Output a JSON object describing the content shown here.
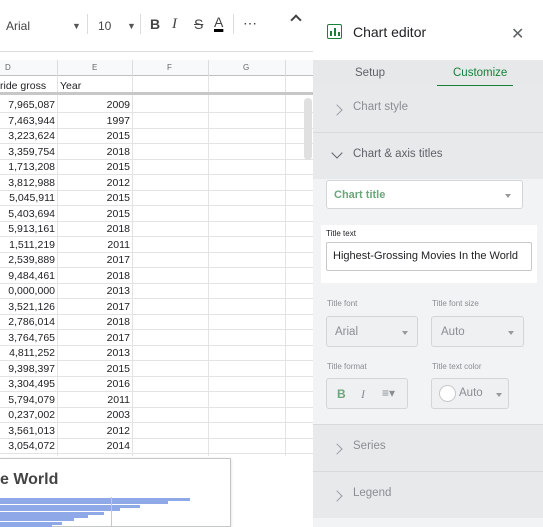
{
  "toolbar": {
    "font_name": "Arial",
    "font_size": "10",
    "bold": "B",
    "italic": "I",
    "strikethrough": "S",
    "text_color": "A",
    "more": "⋯"
  },
  "columns": [
    "D",
    "E",
    "F",
    "G"
  ],
  "sheet": {
    "header_gross": "ride gross",
    "header_year": "Year",
    "rows": [
      {
        "gross": "7,965,087",
        "year": "2009"
      },
      {
        "gross": "7,463,944",
        "year": "1997"
      },
      {
        "gross": "3,223,624",
        "year": "2015"
      },
      {
        "gross": "3,359,754",
        "year": "2018"
      },
      {
        "gross": "1,713,208",
        "year": "2015"
      },
      {
        "gross": "3,812,988",
        "year": "2012"
      },
      {
        "gross": "5,045,911",
        "year": "2015"
      },
      {
        "gross": "5,403,694",
        "year": "2015"
      },
      {
        "gross": "5,913,161",
        "year": "2018"
      },
      {
        "gross": "1,511,219",
        "year": "2011"
      },
      {
        "gross": "2,539,889",
        "year": "2017"
      },
      {
        "gross": "9,484,461",
        "year": "2018"
      },
      {
        "gross": "0,000,000",
        "year": "2013"
      },
      {
        "gross": "3,521,126",
        "year": "2017"
      },
      {
        "gross": "2,786,014",
        "year": "2018"
      },
      {
        "gross": "3,764,765",
        "year": "2017"
      },
      {
        "gross": "4,811,252",
        "year": "2013"
      },
      {
        "gross": "9,398,397",
        "year": "2015"
      },
      {
        "gross": "3,304,495",
        "year": "2016"
      },
      {
        "gross": "5,794,079",
        "year": "2011"
      },
      {
        "gross": "0,237,002",
        "year": "2003"
      },
      {
        "gross": "3,561,013",
        "year": "2012"
      },
      {
        "gross": "3,054,072",
        "year": "2014"
      }
    ]
  },
  "chart_preview": {
    "title": "e World",
    "bar_fractions": [
      0.95,
      0.84,
      0.7,
      0.6,
      0.52,
      0.44,
      0.37,
      0.31,
      0.26
    ],
    "bar_color": "#8fa8e8"
  },
  "editor": {
    "title": "Chart editor",
    "close": "✕",
    "tabs": {
      "setup": "Setup",
      "customize": "Customize"
    },
    "sections": {
      "chart_style": "Chart style",
      "chart_axis_titles": "Chart & axis titles",
      "series": "Series",
      "legend": "Legend"
    },
    "title_type_dropdown": "Chart title",
    "title_text_caption": "Title text",
    "title_text_value": "Highest-Grossing Movies In the World",
    "title_font_caption": "Title font",
    "title_font_value": "Arial",
    "title_font_size_caption": "Title font size",
    "title_font_size_value": "Auto",
    "title_format_caption": "Title format",
    "format_bold": "B",
    "format_italic": "I",
    "format_align": "≡▾",
    "title_text_color_caption": "Title text color",
    "title_text_color_value": "Auto",
    "accent_color": "#188038"
  }
}
